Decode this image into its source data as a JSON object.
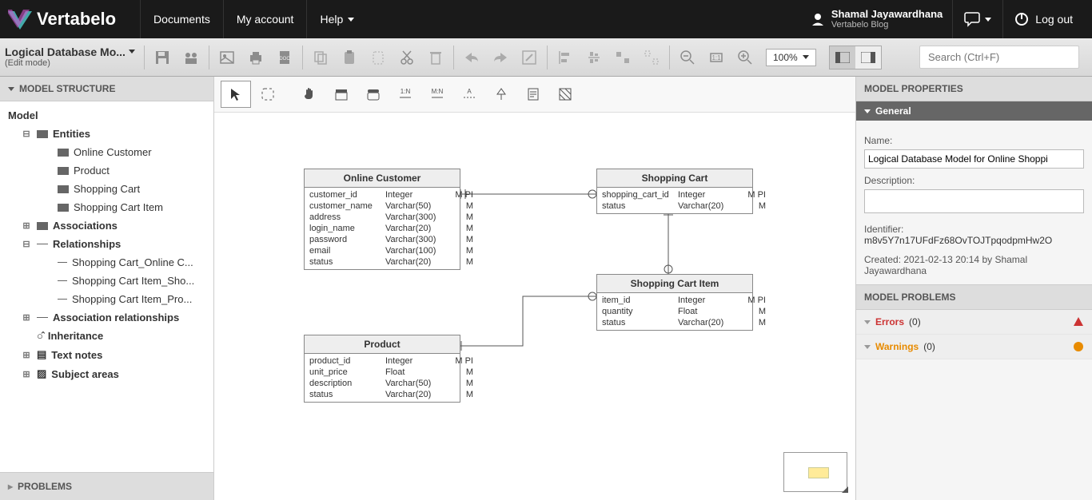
{
  "topbar": {
    "brand": "Vertabelo",
    "links": {
      "documents": "Documents",
      "account": "My account",
      "help": "Help"
    },
    "user": {
      "name": "Shamal Jayawardhana",
      "sub": "Vertabelo Blog"
    },
    "logout": "Log out"
  },
  "toolbar": {
    "doc_name": "Logical Database Mo...",
    "doc_mode": "(Edit mode)",
    "zoom": "100%",
    "search_placeholder": "Search (Ctrl+F)"
  },
  "sidebar": {
    "header": "MODEL STRUCTURE",
    "root": "Model",
    "entities_label": "Entities",
    "entities": [
      "Online Customer",
      "Product",
      "Shopping Cart",
      "Shopping Cart Item"
    ],
    "associations_label": "Associations",
    "relationships_label": "Relationships",
    "relationships": [
      "Shopping Cart_Online C...",
      "Shopping Cart Item_Sho...",
      "Shopping Cart Item_Pro..."
    ],
    "assoc_rel_label": "Association relationships",
    "inheritance_label": "Inheritance",
    "text_notes_label": "Text notes",
    "subject_areas_label": "Subject areas",
    "problems_header": "PROBLEMS"
  },
  "canvas": {
    "entities": {
      "online_customer": {
        "title": "Online Customer",
        "attrs": [
          {
            "n": "customer_id",
            "t": "Integer",
            "f": "M PI"
          },
          {
            "n": "customer_name",
            "t": "Varchar(50)",
            "f": "M"
          },
          {
            "n": "address",
            "t": "Varchar(300)",
            "f": "M"
          },
          {
            "n": "login_name",
            "t": "Varchar(20)",
            "f": "M"
          },
          {
            "n": "password",
            "t": "Varchar(300)",
            "f": "M"
          },
          {
            "n": "email",
            "t": "Varchar(100)",
            "f": "M"
          },
          {
            "n": "status",
            "t": "Varchar(20)",
            "f": "M"
          }
        ]
      },
      "shopping_cart": {
        "title": "Shopping Cart",
        "attrs": [
          {
            "n": "shopping_cart_id",
            "t": "Integer",
            "f": "M PI"
          },
          {
            "n": "status",
            "t": "Varchar(20)",
            "f": "M"
          }
        ]
      },
      "shopping_cart_item": {
        "title": "Shopping Cart Item",
        "attrs": [
          {
            "n": "item_id",
            "t": "Integer",
            "f": "M PI"
          },
          {
            "n": "quantity",
            "t": "Float",
            "f": "M"
          },
          {
            "n": "status",
            "t": "Varchar(20)",
            "f": "M"
          }
        ]
      },
      "product": {
        "title": "Product",
        "attrs": [
          {
            "n": "product_id",
            "t": "Integer",
            "f": "M PI"
          },
          {
            "n": "unit_price",
            "t": "Float",
            "f": "M"
          },
          {
            "n": "description",
            "t": "Varchar(50)",
            "f": "M"
          },
          {
            "n": "status",
            "t": "Varchar(20)",
            "f": "M"
          }
        ]
      }
    }
  },
  "rpanel": {
    "header": "MODEL PROPERTIES",
    "general": "General",
    "name_label": "Name:",
    "name_value": "Logical Database Model for Online Shoppi",
    "desc_label": "Description:",
    "identifier_label": "Identifier:",
    "identifier_value": "m8v5Y7n17UFdFz68OvTOJTpqodpmHw2O",
    "created": "Created: 2021-02-13 20:14 by Shamal Jayawardhana",
    "problems_header": "MODEL PROBLEMS",
    "errors_label": "Errors",
    "errors_count": "(0)",
    "warnings_label": "Warnings",
    "warnings_count": "(0)"
  }
}
